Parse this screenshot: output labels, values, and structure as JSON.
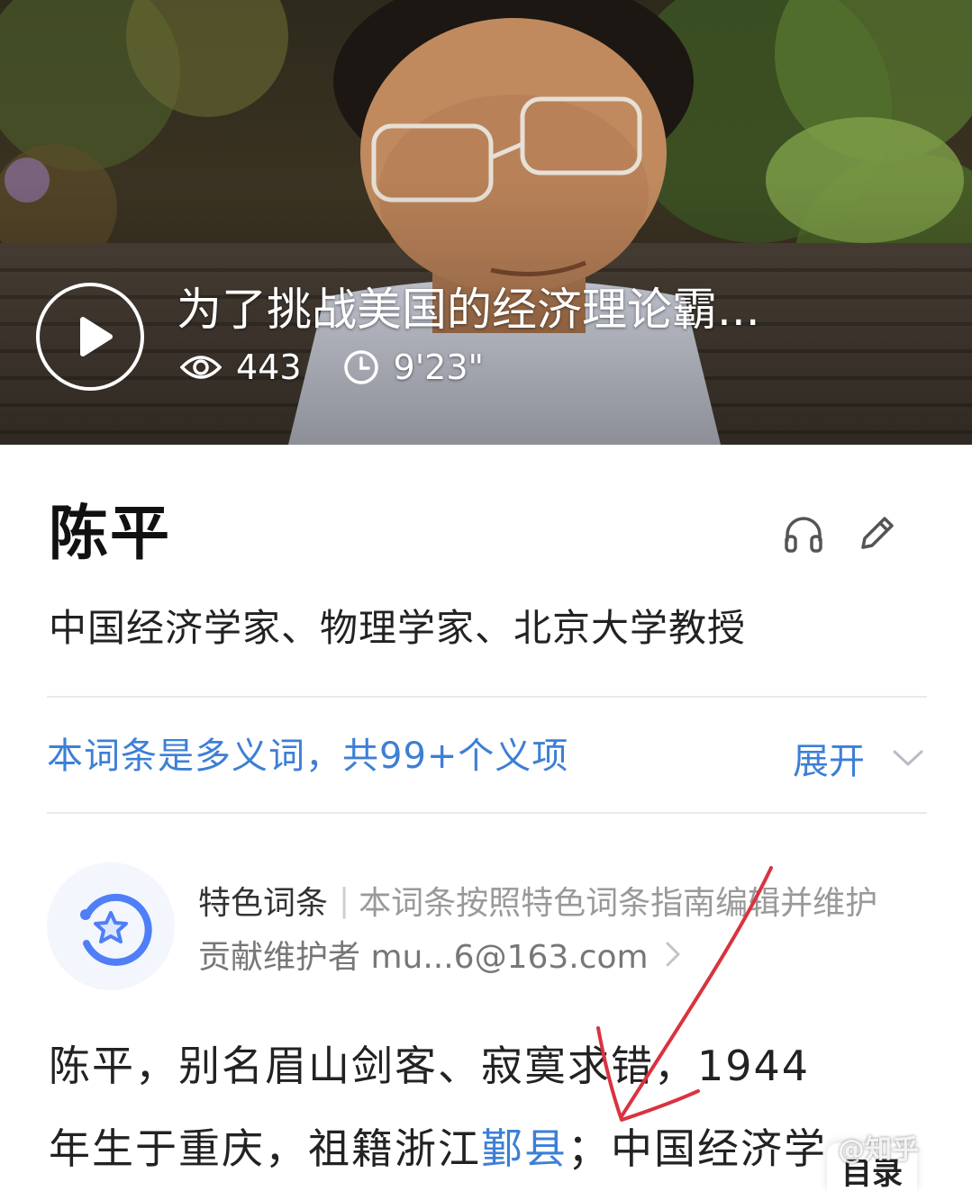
{
  "video": {
    "title": "为了挑战美国的经济理论霸...",
    "views": "443",
    "duration": "9'23\""
  },
  "entry": {
    "title": "陈平",
    "description": "中国经济学家、物理学家、北京大学教授"
  },
  "polysemy": {
    "text": "本词条是多义词，共99+个义项",
    "expand_label": "展开"
  },
  "featured": {
    "tag": "特色词条",
    "separator": "|",
    "note": "本词条按照特色词条指南编辑并维护",
    "contributor": "贡献维护者 mu...6@163.com"
  },
  "body": {
    "line1": "陈平，别名眉山剑客、寂寞求错，1944",
    "line2_prefix": "年生于重庆，祖籍浙江",
    "line2_link": "鄞县",
    "line2_suffix": "；中国经济学"
  },
  "toc_label": "目录",
  "watermark": "@知乎",
  "colors": {
    "link": "#3d7fd6",
    "annotation_arrow": "#d9333f",
    "title": "#111111",
    "muted": "#999999"
  },
  "icons": {
    "play": "play-icon",
    "views": "eye-icon",
    "duration": "clock-icon",
    "listen": "headphones-icon",
    "edit": "pencil-icon",
    "expand": "chevron-down-icon",
    "featured": "star-badge-icon",
    "contributor_more": "chevron-right-icon"
  }
}
